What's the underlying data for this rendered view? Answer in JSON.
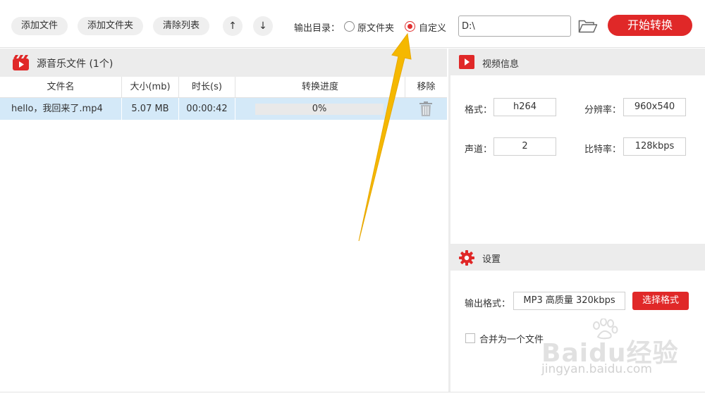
{
  "toolbar": {
    "add_file": "添加文件",
    "add_folder": "添加文件夹",
    "clear_list": "清除列表",
    "move_up": "↑",
    "move_down": "↓",
    "output_dir_label": "输出目录：",
    "option_original": "原文件夹",
    "option_custom": "自定义",
    "selected_option": "自定义",
    "path_value": "D:\\",
    "start_button": "开始转换",
    "icons": [
      "arrow-up-icon",
      "arrow-down-icon",
      "folder-open-icon"
    ]
  },
  "file_panel": {
    "title": "源音乐文件 (1个)",
    "icon": "music-video-icon",
    "columns": [
      "文件名",
      "大小(mb)",
      "时长(s)",
      "转换进度",
      "移除"
    ],
    "rows": [
      {
        "name": "hello，我回来了.mp4",
        "size": "5.07 MB",
        "duration": "00:00:42",
        "progress_percent": 0,
        "progress_text": "0%",
        "remove_icon": "trash-icon"
      }
    ]
  },
  "video_info": {
    "title": "视频信息",
    "icon": "play-icon",
    "format_label": "格式：",
    "format_value": "h264",
    "resolution_label": "分辨率：",
    "resolution_value": "960x540",
    "channels_label": "声道：",
    "channels_value": "2",
    "bitrate_label": "比特率：",
    "bitrate_value": "128kbps"
  },
  "settings": {
    "title": "设置",
    "icon": "gear-icon",
    "output_format_label": "输出格式：",
    "output_format_value": "MP3 高质量 320kbps",
    "select_format_button": "选择格式",
    "merge_label": "合并为一个文件",
    "merge_checked": false
  },
  "watermark": {
    "brand": "Baidu经验",
    "url": "jingyan.baidu.com"
  },
  "colors": {
    "accent": "#e02828",
    "selected_row": "#d4e9f8",
    "header_bg": "#ececec",
    "annotation_arrow": "#f5b800"
  }
}
